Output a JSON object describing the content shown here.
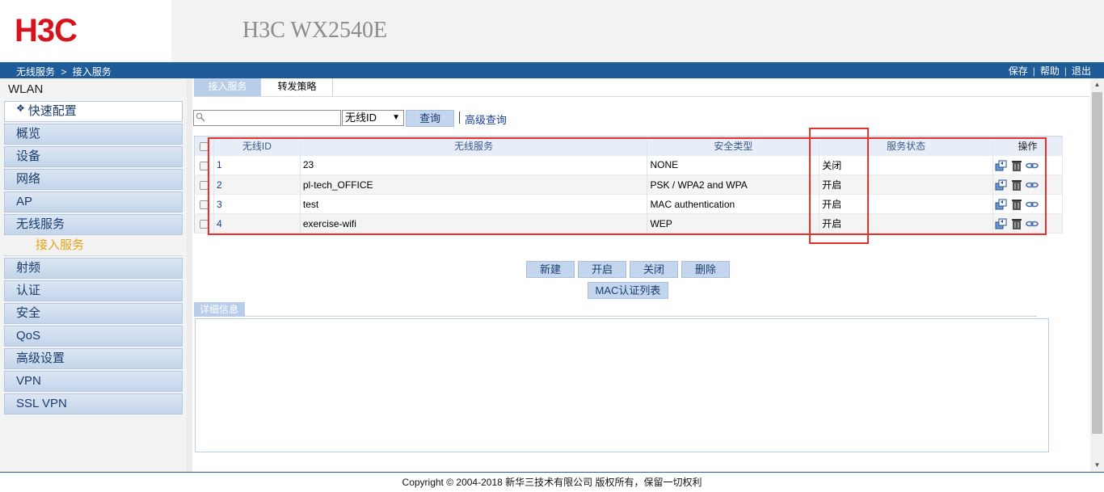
{
  "header": {
    "logo": "H3C",
    "product_title": "H3C WX2540E"
  },
  "navbar": {
    "breadcrumb": [
      "无线服务",
      ">",
      "接入服务"
    ],
    "links": [
      "保存",
      "帮助",
      "退出"
    ]
  },
  "sidebar": {
    "title": "WLAN",
    "quick_config": "快速配置",
    "items": [
      "概览",
      "设备",
      "网络",
      "AP",
      "无线服务"
    ],
    "sub_item": "接入服务",
    "items_after": [
      "射频",
      "认证",
      "安全",
      "QoS",
      "高级设置",
      "VPN",
      "SSL VPN"
    ]
  },
  "tabs": [
    "接入服务",
    "转发策略"
  ],
  "search": {
    "placeholder": "",
    "field_selected": "无线ID",
    "button": "查询",
    "advanced": "高级查询"
  },
  "table": {
    "headers": [
      "无线ID",
      "无线服务",
      "安全类型",
      "服务状态",
      "操作"
    ],
    "rows": [
      {
        "id": "1",
        "service": "23",
        "security": "NONE",
        "status": "关闭"
      },
      {
        "id": "2",
        "service": "pl-tech_OFFICE",
        "security": "PSK / WPA2 and WPA",
        "status": "开启"
      },
      {
        "id": "3",
        "service": "test",
        "security": "MAC authentication",
        "status": "开启"
      },
      {
        "id": "4",
        "service": "exercise-wifi",
        "security": "WEP",
        "status": "开启"
      }
    ],
    "row_icons": [
      "copy-icon",
      "delete-icon",
      "link-icon"
    ]
  },
  "actions": {
    "new": "新建",
    "enable": "开启",
    "disable": "关闭",
    "delete": "删除",
    "mac_list": "MAC认证列表"
  },
  "details": {
    "tab": "详细信息"
  },
  "footer": "Copyright © 2004-2018 新华三技术有限公司 版权所有，保留一切权利",
  "colors": {
    "brand": "#d7121b",
    "nav": "#1f5a99",
    "annotation": "#e8312a"
  }
}
